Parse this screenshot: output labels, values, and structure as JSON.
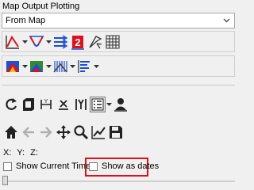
{
  "panel": {
    "title": "Map Output Plotting",
    "source_select": {
      "value": "From Map"
    }
  },
  "toolbar_row1": {
    "icons": [
      "curve-up-icon",
      "curve-down-icon",
      "three-lines-icon",
      "numbered-2-icon",
      "flag-pointer-icon",
      "grid-icon"
    ]
  },
  "toolbar_row2": {
    "icons": [
      "colored-map-icon",
      "colored-map-2-icon",
      "curtain-chart-icon",
      "legend-bars-icon"
    ]
  },
  "toolbar_row3": {
    "icons": [
      "refresh-icon",
      "square-icon",
      "xy-axis-icon",
      "x-axis-icon",
      "y-axis-icon",
      "list-options-icon",
      "person-icon"
    ]
  },
  "toolbar_row4": {
    "icons": [
      "home-icon",
      "back-arrow-icon",
      "forward-arrow-icon",
      "pan-icon",
      "zoom-icon",
      "line-chart-icon",
      "save-icon"
    ]
  },
  "coords": {
    "x_label": "X:",
    "y_label": "Y:",
    "z_label": "Z:"
  },
  "options": {
    "show_current_time": {
      "label": "Show Current Time",
      "checked": false
    },
    "show_as_dates": {
      "label": "Show as dates",
      "checked": false
    }
  },
  "colors": {
    "accent_red": "#e0101a",
    "accent_blue": "#1b4fd8"
  }
}
